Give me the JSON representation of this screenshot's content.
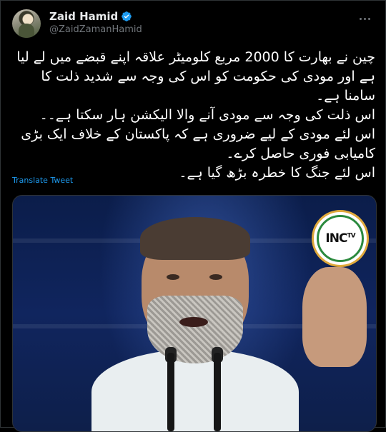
{
  "author": {
    "name": "Zaid Hamid",
    "handle": "@ZaidZamanHamid",
    "verified": true
  },
  "tweet": {
    "lines": [
      "چین نے بھارت کا 2000 مربع کلومیٹر علاقہ اپنے قبضے میں لے لیا ہے اور مودی کی حکومت کو اس کی وجہ سے شدید ذلت کا سامنا ہے۔",
      "اس ذلت کی وجہ سے مودی آنے والا الیکشن ہار سکتا ہے۔۔",
      "اس لئے مودی کے لیے ضروری ہے کہ پاکستان کے خلاف ایک بڑی کامیابی فوری حاصل کرے۔",
      "اس لئے جنگ کا خطرہ بڑھ گیا ہے۔"
    ],
    "translate_label": "Translate Tweet"
  },
  "media": {
    "logo_text": "INC",
    "logo_sup": "TV"
  },
  "icons": {
    "verified": "verified-badge-icon",
    "more": "more-options-icon"
  },
  "colors": {
    "background": "#000000",
    "text": "#e7e9ea",
    "secondary": "#71767b",
    "accent": "#1d9bf0"
  }
}
